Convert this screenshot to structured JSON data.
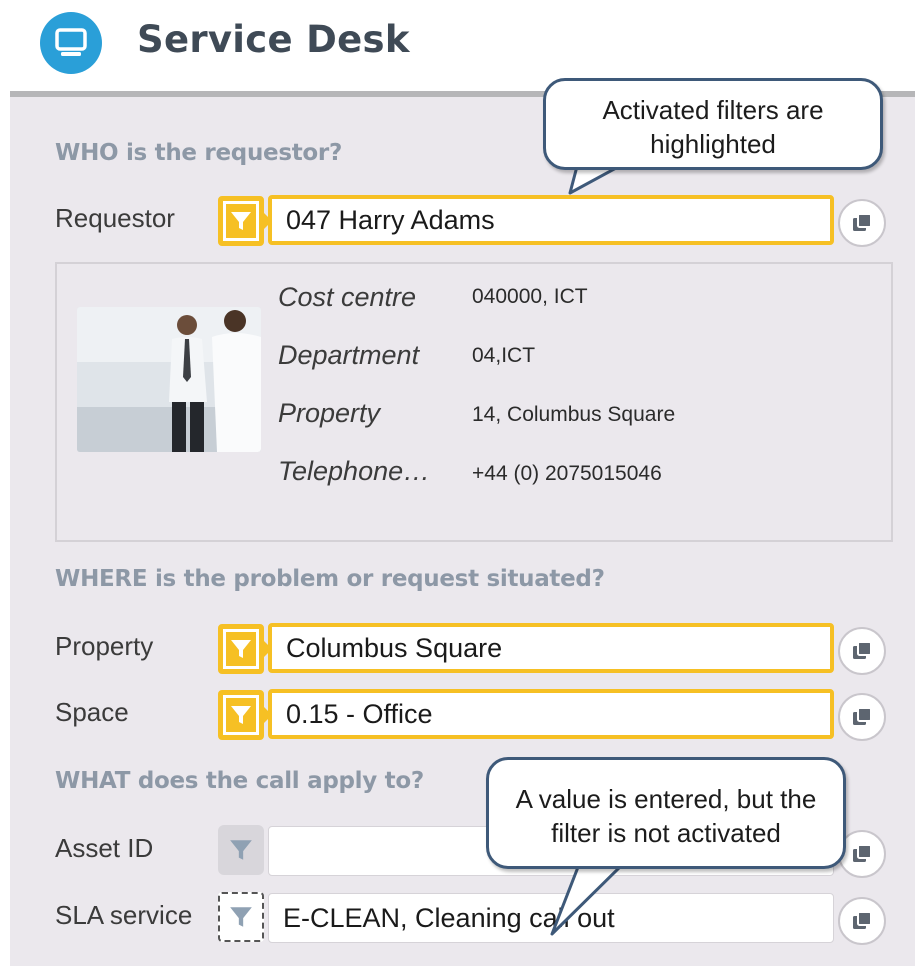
{
  "app": {
    "title": "Service Desk",
    "icon": "monitor-icon",
    "accent_color": "#2a9fd8"
  },
  "callouts": {
    "activated": "Activated filters are highlighted",
    "not_activated": "A value is entered, but the filter is not activated"
  },
  "sections": {
    "who": "WHO is the requestor?",
    "where": "WHERE is the problem or request situated?",
    "what": "WHAT does the call apply to?"
  },
  "fields": {
    "requestor": {
      "label": "Requestor",
      "value": "047 Harry Adams",
      "filter_active": true
    },
    "property": {
      "label": "Property",
      "value": "Columbus Square",
      "filter_active": true
    },
    "space": {
      "label": "Space",
      "value": "0.15 - Office",
      "filter_active": true
    },
    "asset_id": {
      "label": "Asset ID",
      "value": "",
      "filter_active": false
    },
    "sla_service": {
      "label": "SLA service",
      "value": "E-CLEAN, Cleaning call out",
      "filter_active": false
    }
  },
  "requestor_details": {
    "cost_centre_label": "Cost centre",
    "cost_centre_value": "040000, ICT",
    "department_label": "Department",
    "department_value": "04,ICT",
    "property_label": "Property",
    "property_value": "14, Columbus Square",
    "telephone_label": "Telephone…",
    "telephone_value": "+44 (0) 2075015046"
  },
  "colors": {
    "highlight": "#f6c024",
    "panel_bg": "#ebe8ed",
    "section_title": "#8d98a6",
    "callout_border": "#3e5979"
  }
}
